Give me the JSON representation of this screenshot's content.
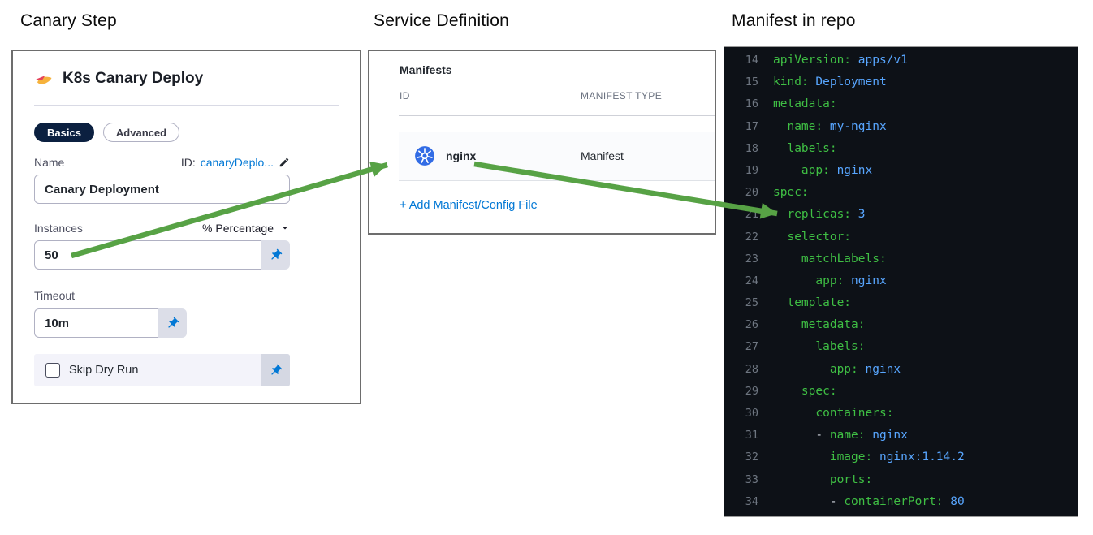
{
  "headings": {
    "canary_step": "Canary Step",
    "service_definition": "Service Definition",
    "manifest_in_repo": "Manifest in repo"
  },
  "canary_panel": {
    "title": "K8s Canary Deploy",
    "tabs": [
      {
        "label": "Basics",
        "active": true
      },
      {
        "label": "Advanced",
        "active": false
      }
    ],
    "name_field": {
      "label": "Name",
      "id_label": "ID:",
      "id_value": "canaryDeplo...",
      "value": "Canary Deployment"
    },
    "instances_field": {
      "label": "Instances",
      "unit_dropdown_value": "% Percentage",
      "value": "50"
    },
    "timeout_field": {
      "label": "Timeout",
      "value": "10m"
    },
    "skip_dry_run": {
      "label": "Skip Dry Run",
      "checked": false
    }
  },
  "service_panel": {
    "section_title": "Manifests",
    "columns": [
      "ID",
      "MANIFEST TYPE"
    ],
    "rows": [
      {
        "icon": "kubernetes-icon",
        "id": "nginx",
        "manifest_type": "Manifest"
      }
    ],
    "add_link": "+ Add Manifest/Config File"
  },
  "code_panel": {
    "language": "yaml",
    "first_line_number": 14,
    "last_line_number": 34,
    "lines": [
      {
        "n": "14",
        "seg": [
          [
            "k",
            "apiVersion:"
          ],
          [
            "v",
            " apps/v1"
          ]
        ]
      },
      {
        "n": "15",
        "seg": [
          [
            "k",
            "kind:"
          ],
          [
            "v",
            " Deployment"
          ]
        ]
      },
      {
        "n": "16",
        "seg": [
          [
            "k",
            "metadata:"
          ]
        ]
      },
      {
        "n": "17",
        "seg": [
          [
            "s",
            "  "
          ],
          [
            "k",
            "name:"
          ],
          [
            "v",
            " my-nginx"
          ]
        ]
      },
      {
        "n": "18",
        "seg": [
          [
            "s",
            "  "
          ],
          [
            "k",
            "labels:"
          ]
        ]
      },
      {
        "n": "19",
        "seg": [
          [
            "s",
            "    "
          ],
          [
            "k",
            "app:"
          ],
          [
            "v",
            " nginx"
          ]
        ]
      },
      {
        "n": "20",
        "seg": [
          [
            "k",
            "spec:"
          ]
        ]
      },
      {
        "n": "21",
        "seg": [
          [
            "s",
            "  "
          ],
          [
            "k",
            "replicas:"
          ],
          [
            "v",
            " 3"
          ]
        ]
      },
      {
        "n": "22",
        "seg": [
          [
            "s",
            "  "
          ],
          [
            "k",
            "selector:"
          ]
        ]
      },
      {
        "n": "23",
        "seg": [
          [
            "s",
            "    "
          ],
          [
            "k",
            "matchLabels:"
          ]
        ]
      },
      {
        "n": "24",
        "seg": [
          [
            "s",
            "      "
          ],
          [
            "k",
            "app:"
          ],
          [
            "v",
            " nginx"
          ]
        ]
      },
      {
        "n": "25",
        "seg": [
          [
            "s",
            "  "
          ],
          [
            "k",
            "template:"
          ]
        ]
      },
      {
        "n": "26",
        "seg": [
          [
            "s",
            "    "
          ],
          [
            "k",
            "metadata:"
          ]
        ]
      },
      {
        "n": "27",
        "seg": [
          [
            "s",
            "      "
          ],
          [
            "k",
            "labels:"
          ]
        ]
      },
      {
        "n": "28",
        "seg": [
          [
            "s",
            "        "
          ],
          [
            "k",
            "app:"
          ],
          [
            "v",
            " nginx"
          ]
        ]
      },
      {
        "n": "29",
        "seg": [
          [
            "s",
            "    "
          ],
          [
            "k",
            "spec:"
          ]
        ]
      },
      {
        "n": "30",
        "seg": [
          [
            "s",
            "      "
          ],
          [
            "k",
            "containers:"
          ]
        ]
      },
      {
        "n": "31",
        "seg": [
          [
            "s",
            "      "
          ],
          [
            "p",
            "- "
          ],
          [
            "k",
            "name:"
          ],
          [
            "v",
            " nginx"
          ]
        ]
      },
      {
        "n": "32",
        "seg": [
          [
            "s",
            "        "
          ],
          [
            "k",
            "image:"
          ],
          [
            "v",
            " nginx:1.14.2"
          ]
        ]
      },
      {
        "n": "33",
        "seg": [
          [
            "s",
            "        "
          ],
          [
            "k",
            "ports:"
          ]
        ]
      },
      {
        "n": "34",
        "seg": [
          [
            "s",
            "        "
          ],
          [
            "p",
            "- "
          ],
          [
            "k",
            "containerPort:"
          ],
          [
            "v",
            " 80"
          ]
        ]
      }
    ]
  },
  "colors": {
    "accent_blue": "#0278d5",
    "tab_active_bg": "#0b2040",
    "kubernetes_blue": "#326ce5",
    "arrow_green": "#57a245",
    "code_background": "#0d1117",
    "code_key_green": "#3fbf44",
    "code_value_blue": "#58a6ff",
    "code_line_number_gray": "#6e7681"
  }
}
